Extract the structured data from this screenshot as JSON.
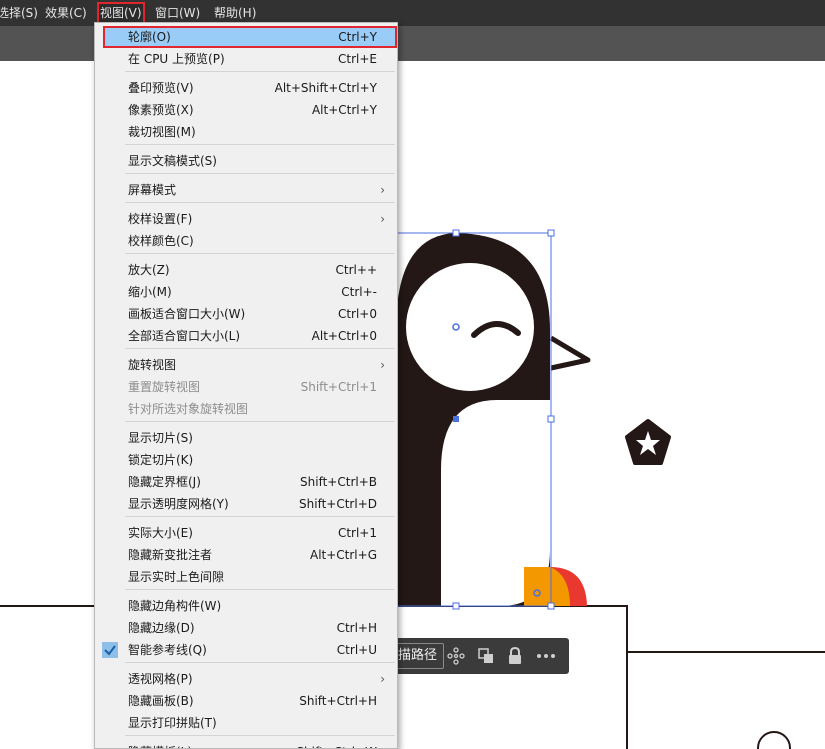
{
  "menubar": {
    "items": [
      "选择(S)",
      "效果(C)",
      "视图(V)",
      "窗口(W)",
      "帮助(H)"
    ]
  },
  "context_toolbar": {
    "label": "描路径",
    "icons": [
      "scatter-points-icon",
      "intersect-icon",
      "lock-icon",
      "more-icon"
    ]
  },
  "menu": {
    "items": [
      {
        "label": "轮廓(O)",
        "shortcut": "Ctrl+Y",
        "highlighted": true
      },
      {
        "label": "在 CPU 上预览(P)",
        "shortcut": "Ctrl+E"
      },
      {
        "label": "叠印预览(V)",
        "shortcut": "Alt+Shift+Ctrl+Y"
      },
      {
        "label": "像素预览(X)",
        "shortcut": "Alt+Ctrl+Y"
      },
      {
        "label": "裁切视图(M)",
        "shortcut": ""
      },
      {
        "label": "显示文稿模式(S)",
        "shortcut": ""
      },
      {
        "label": "屏幕模式",
        "shortcut": "",
        "submenu": true
      },
      {
        "label": "校样设置(F)",
        "shortcut": "",
        "submenu": true
      },
      {
        "label": "校样颜色(C)",
        "shortcut": ""
      },
      {
        "label": "放大(Z)",
        "shortcut": "Ctrl++"
      },
      {
        "label": "缩小(M)",
        "shortcut": "Ctrl+-"
      },
      {
        "label": "画板适合窗口大小(W)",
        "shortcut": "Ctrl+0"
      },
      {
        "label": "全部适合窗口大小(L)",
        "shortcut": "Alt+Ctrl+0"
      },
      {
        "label": "旋转视图",
        "shortcut": "",
        "submenu": true
      },
      {
        "label": "重置旋转视图",
        "shortcut": "Shift+Ctrl+1",
        "disabled": true
      },
      {
        "label": "针对所选对象旋转视图",
        "shortcut": "",
        "disabled": true
      },
      {
        "label": "显示切片(S)",
        "shortcut": ""
      },
      {
        "label": "锁定切片(K)",
        "shortcut": ""
      },
      {
        "label": "隐藏定界框(J)",
        "shortcut": "Shift+Ctrl+B"
      },
      {
        "label": "显示透明度网格(Y)",
        "shortcut": "Shift+Ctrl+D"
      },
      {
        "label": "实际大小(E)",
        "shortcut": "Ctrl+1"
      },
      {
        "label": "隐藏新变批注者",
        "shortcut": "Alt+Ctrl+G"
      },
      {
        "label": "显示实时上色间隙",
        "shortcut": ""
      },
      {
        "label": "隐藏边角构件(W)",
        "shortcut": ""
      },
      {
        "label": "隐藏边缘(D)",
        "shortcut": "Ctrl+H"
      },
      {
        "label": "智能参考线(Q)",
        "shortcut": "Ctrl+U",
        "checked": true
      },
      {
        "label": "透视网格(P)",
        "shortcut": "",
        "submenu": true
      },
      {
        "label": "隐藏画板(B)",
        "shortcut": "Shift+Ctrl+H"
      },
      {
        "label": "显示打印拼贴(T)",
        "shortcut": ""
      },
      {
        "label": "隐藏模板(L)",
        "shortcut": "Shift+Ctrl+W"
      }
    ]
  },
  "colors": {
    "menubar_bg": "#323232",
    "menu_bg": "#f0f0f0",
    "highlight": "#99ccf7",
    "selection_blue": "#4a6fe0",
    "annotation_red": "#e0262f",
    "penguin_dark": "#231815",
    "orange": "#f39800",
    "red": "#e8382f"
  }
}
